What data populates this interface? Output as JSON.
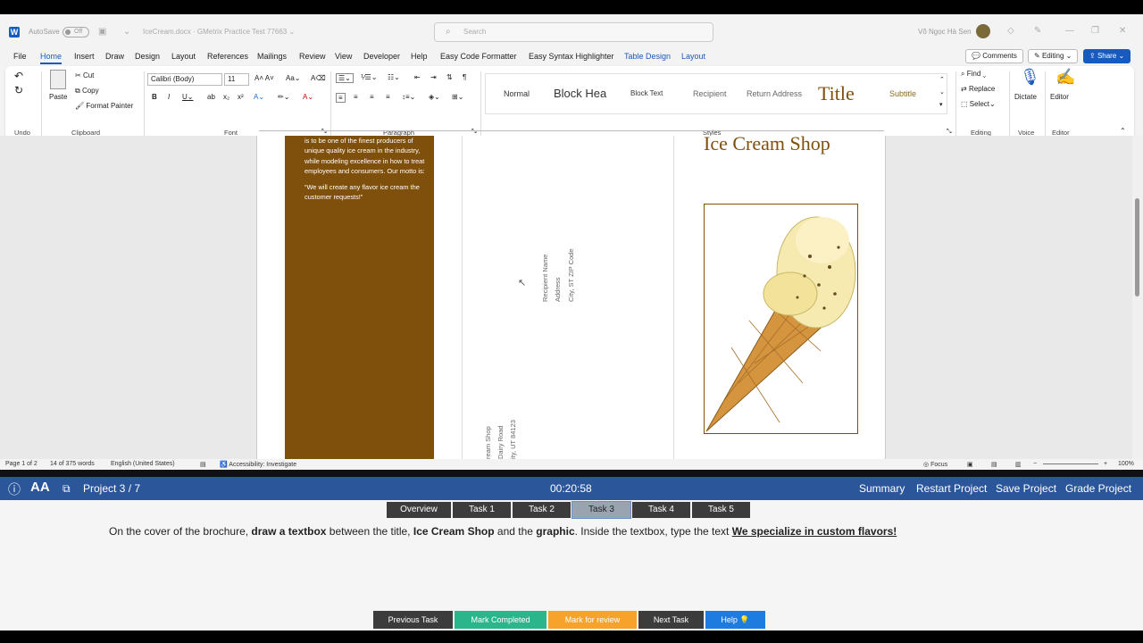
{
  "titlebar": {
    "autosave_label": "AutoSave",
    "autosave_state": "Off",
    "document_title": "IceCream.docx · GMetrix Practice Test 77663 ⌄",
    "search_placeholder": "Search",
    "user_name": "Võ Ngọc Hà Sen"
  },
  "menu": {
    "tabs": [
      "File",
      "Home",
      "Insert",
      "Draw",
      "Design",
      "Layout",
      "References",
      "Mailings",
      "Review",
      "View",
      "Developer",
      "Help",
      "Easy Code Formatter",
      "Easy Syntax Highlighter",
      "Table Design",
      "Layout"
    ],
    "active_tab": "Home",
    "comments": "Comments",
    "editing": "Editing",
    "share": "Share"
  },
  "ribbon": {
    "undo_label": "Undo",
    "clipboard": {
      "paste": "Paste",
      "cut": "Cut",
      "copy": "Copy",
      "format_painter": "Format Painter",
      "label": "Clipboard"
    },
    "font": {
      "family": "Calibri (Body)",
      "size": "11",
      "label": "Font"
    },
    "paragraph_label": "Paragraph",
    "styles": {
      "items": [
        "Normal",
        "Block Hea",
        "Block Text",
        "Recipient",
        "Return Address",
        "Title",
        "Subtitle"
      ],
      "label": "Styles"
    },
    "editing": {
      "find": "Find",
      "replace": "Replace",
      "select": "Select",
      "label": "Editing"
    },
    "voice": {
      "dictate": "Dictate",
      "label": "Voice"
    },
    "editor": {
      "editor": "Editor",
      "label": "Editor"
    }
  },
  "document": {
    "panel_text_1": "is to be one of the finest producers of unique quality ice cream in the industry, while modeling excellence in how to treat employees and consumers.  Our motto is:",
    "panel_text_2": "“We will create any flavor ice cream the customer requests!”",
    "recipient_name": "Recipient Name",
    "recipient_address": "Address",
    "recipient_city": "City, ST  ZIP Code",
    "return_line1": "ream Shop",
    "return_line2": "Dairy Road",
    "return_line3": "ity, UT 84123",
    "shop_title": "Ice Cream Shop",
    "brand_color": "#7f4f0c"
  },
  "statusbar": {
    "page": "Page 1 of 2",
    "words": "14 of 375 words",
    "language": "English (United States)",
    "accessibility": "Accessibility: Investigate",
    "focus": "Focus",
    "zoom": "100%"
  },
  "gmetrix": {
    "project": "Project 3 / 7",
    "timer": "00:20:58",
    "summary": "Summary",
    "restart": "Restart Project",
    "save": "Save Project",
    "grade": "Grade Project",
    "tabs": [
      "Overview",
      "Task 1",
      "Task 2",
      "Task 3",
      "Task 4",
      "Task 5"
    ],
    "active_tab": "Task 3",
    "instruction": {
      "p1": "On the cover of the brochure, ",
      "b1": "draw a textbox",
      "p2": " between the title, ",
      "b2": "Ice Cream Shop",
      "p3": " and the ",
      "b3": "graphic",
      "p4": ". Inside the textbox, type the text ",
      "u1": "We specialize in custom flavors!"
    },
    "buttons": {
      "previous": "Previous Task",
      "completed": "Mark Completed",
      "review": "Mark for review",
      "next": "Next Task",
      "help": "Help"
    },
    "colors": {
      "bar": "#2b579a",
      "previous": "#3c3c3c",
      "completed": "#2bb58a",
      "review": "#f7a32b",
      "next": "#3c3c3c",
      "help": "#1e7be0"
    }
  }
}
